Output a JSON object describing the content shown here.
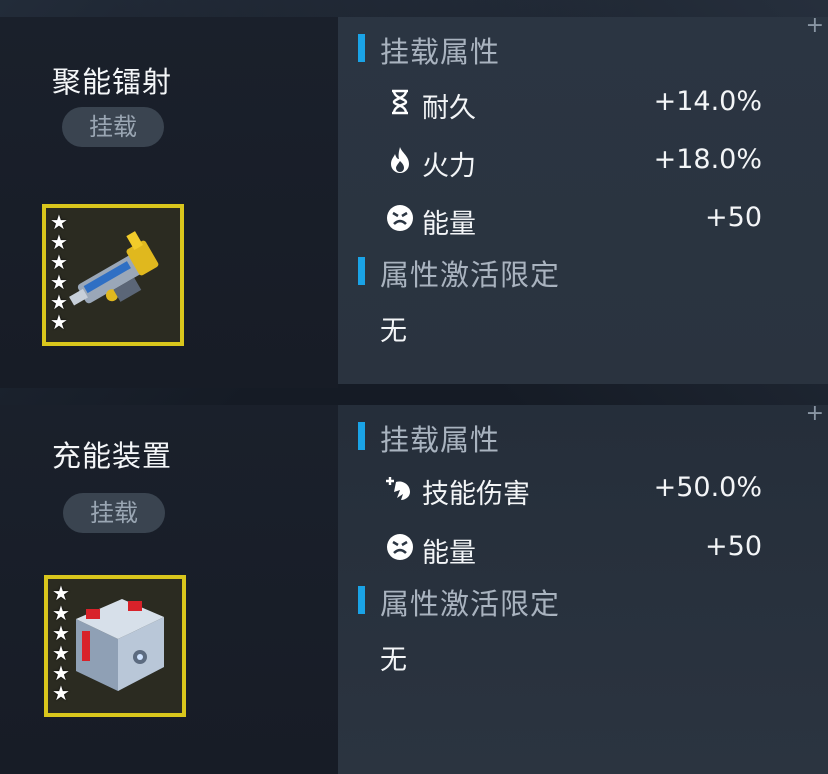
{
  "items": [
    {
      "name": "聚能镭射",
      "badge": "挂载",
      "section_mount": "挂载属性",
      "attributes": [
        {
          "icon": "hourglass-icon",
          "label": "耐久",
          "value": "+14.0%"
        },
        {
          "icon": "fire-icon",
          "label": "火力",
          "value": "+18.0%"
        },
        {
          "icon": "energy-face-icon",
          "label": "能量",
          "value": "+50"
        }
      ],
      "section_limit": "属性激活限定",
      "limit_value": "无",
      "stars": 6
    },
    {
      "name": "充能装置",
      "badge": "挂载",
      "section_mount": "挂载属性",
      "attributes": [
        {
          "icon": "skill-damage-icon",
          "label": "技能伤害",
          "value": "+50.0%"
        },
        {
          "icon": "energy-face-icon",
          "label": "能量",
          "value": "+50"
        }
      ],
      "section_limit": "属性激活限定",
      "limit_value": "无",
      "stars": 6
    }
  ],
  "colors": {
    "accent": "#1aa3e6",
    "frame": "#d9c61c"
  }
}
